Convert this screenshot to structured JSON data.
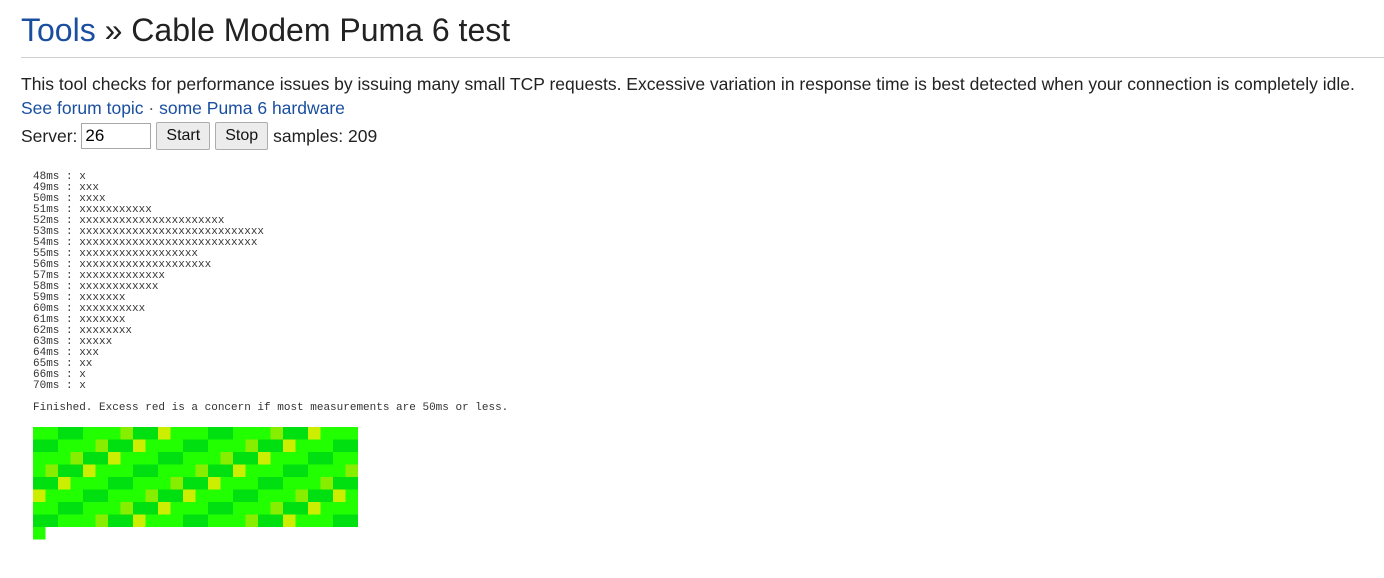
{
  "header": {
    "link": "Tools",
    "sep": " » ",
    "title": "Cable Modem Puma 6 test"
  },
  "description": "This tool checks for performance issues by issuing many small TCP requests. Excessive variation in response time is best detected when your connection is completely idle.",
  "links": [
    {
      "label": "See forum topic"
    },
    {
      "label": "some Puma 6 hardware"
    }
  ],
  "link_separator": " · ",
  "controls": {
    "server_label": "Server:",
    "server_value": "26",
    "start_label": "Start",
    "stop_label": "Stop",
    "samples_text": "samples: 209"
  },
  "histogram": [
    {
      "label": "48ms",
      "count": 1
    },
    {
      "label": "49ms",
      "count": 3
    },
    {
      "label": "50ms",
      "count": 4
    },
    {
      "label": "51ms",
      "count": 11
    },
    {
      "label": "52ms",
      "count": 22
    },
    {
      "label": "53ms",
      "count": 28
    },
    {
      "label": "54ms",
      "count": 27
    },
    {
      "label": "55ms",
      "count": 18
    },
    {
      "label": "56ms",
      "count": 20
    },
    {
      "label": "57ms",
      "count": 13
    },
    {
      "label": "58ms",
      "count": 12
    },
    {
      "label": "59ms",
      "count": 7
    },
    {
      "label": "60ms",
      "count": 10
    },
    {
      "label": "61ms",
      "count": 7
    },
    {
      "label": "62ms",
      "count": 8
    },
    {
      "label": "63ms",
      "count": 5
    },
    {
      "label": "64ms",
      "count": 3
    },
    {
      "label": "65ms",
      "count": 2
    },
    {
      "label": "66ms",
      "count": 1
    },
    {
      "label": "70ms",
      "count": 1
    }
  ],
  "status_text": "Finished. Excess red is a concern if most measurements are 50ms or less.",
  "heatmap": {
    "columns": 26,
    "samples": 209,
    "colors": {
      "good": "#22ff00",
      "mid": "#88ee00",
      "warn": "#ccee00",
      "alt": "#00e010"
    }
  }
}
